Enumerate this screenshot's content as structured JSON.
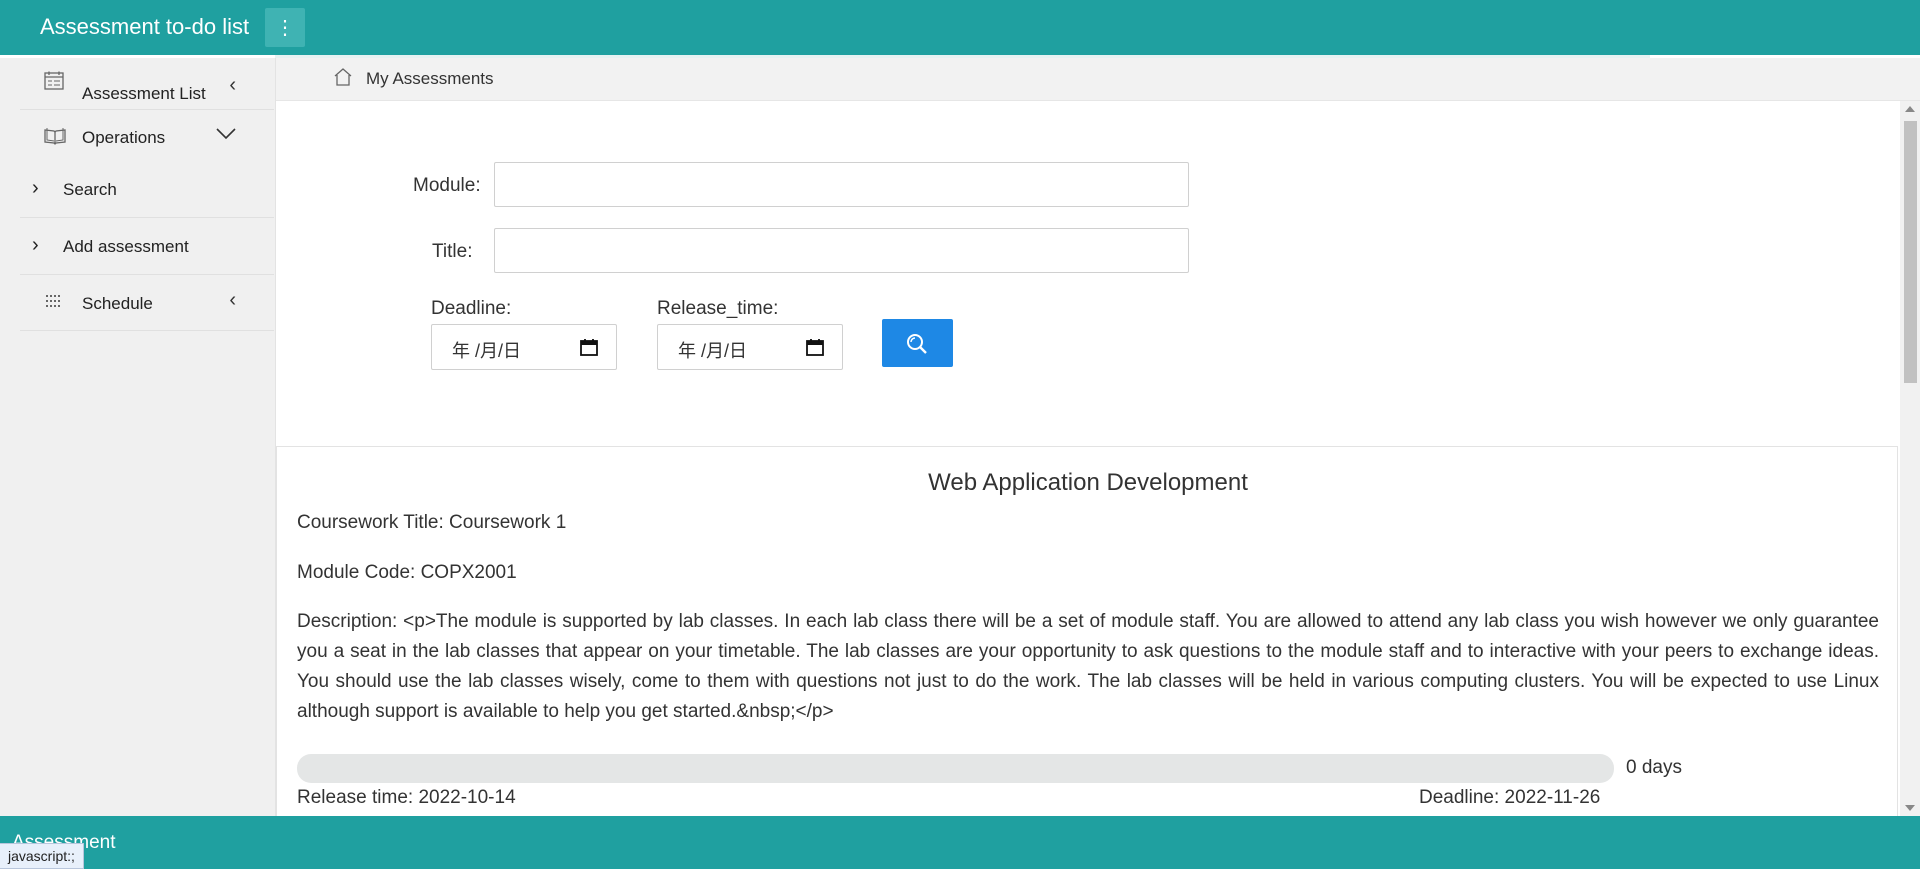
{
  "app": {
    "title": "Assessment to-do list",
    "menu_icon": "more-vertical-icon"
  },
  "colors": {
    "brand": "#1fa0a0",
    "primary_button": "#1e88e5",
    "progress_track": "#e4e6e6"
  },
  "sidebar": {
    "items": [
      {
        "label": "Assessment List",
        "icon": "calendar-list-icon",
        "caret": "‹"
      },
      {
        "label": "Operations",
        "icon": "book-icon",
        "caret": "⌄"
      },
      {
        "label": "Search",
        "icon": "chevron-right-icon",
        "prefix": "›"
      },
      {
        "label": "Add assessment",
        "icon": "chevron-right-icon",
        "prefix": "›"
      },
      {
        "label": "Schedule",
        "icon": "grid-icon",
        "caret": "‹"
      }
    ]
  },
  "breadcrumb": {
    "icon": "home-icon",
    "label": "My Assessments"
  },
  "search_form": {
    "module_label": "Module:",
    "module_value": "",
    "title_label": "Title:",
    "title_value": "",
    "deadline_label": "Deadline:",
    "deadline_value": "年 /月/日",
    "release_label": "Release_time:",
    "release_value": "年 /月/日",
    "search_icon": "search-icon"
  },
  "assessment": {
    "module_name": "Web Application Development",
    "coursework_title": "Coursework Title: Coursework 1",
    "module_code": "Module Code: COPX2001",
    "description": "Description: <p>The module is supported by lab classes. In each lab class there will be a set of module staff. You are allowed to attend any lab class you wish however we only guarantee you a seat in the lab classes that appear on your timetable. The lab classes are your opportunity to ask questions to the module staff and to interactive with your peers to exchange ideas. You should use the lab classes wisely, come to them with questions not just to do the work. The lab classes will be held in various computing clusters. You will be expected to use Linux although support is available to help you get started.&nbsp;</p>",
    "progress_percent": 0,
    "days_remaining": "0 days",
    "release_time": "Release time: 2022-10-14",
    "deadline": "Deadline: 2022-11-26"
  },
  "footer": {
    "text": "Assessment"
  },
  "status_bar": {
    "link_preview": "javascript:;"
  }
}
